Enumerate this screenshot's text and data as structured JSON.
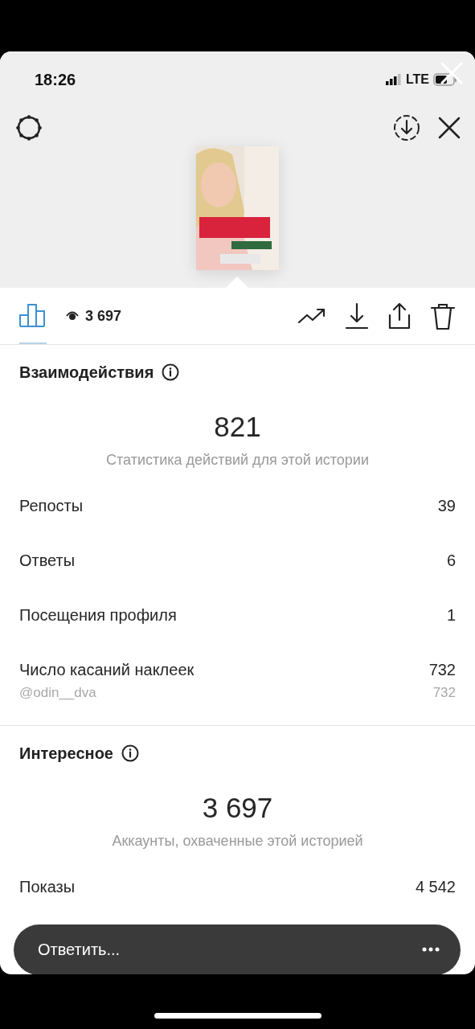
{
  "status_bar": {
    "time": "18:26",
    "network": "LTE"
  },
  "toolbar": {
    "insights_tab": {
      "selected": true
    },
    "views": "3 697"
  },
  "sections": [
    {
      "title": "Взаимодействия",
      "total": "821",
      "caption": "Статистика действий для этой истории",
      "rows": [
        {
          "kind": "main",
          "label": "Репосты",
          "value": "39"
        },
        {
          "kind": "main",
          "label": "Ответы",
          "value": "6"
        },
        {
          "kind": "main",
          "label": "Посещения профиля",
          "value": "1"
        },
        {
          "kind": "main",
          "label": "Число касаний наклеек",
          "value": "732"
        },
        {
          "kind": "sub",
          "label": "@odin__dva",
          "value": "732"
        }
      ]
    },
    {
      "title": "Интересное",
      "total": "3 697",
      "caption": "Аккаунты, охваченные этой историей",
      "rows": [
        {
          "kind": "main",
          "label": "Показы",
          "value": "4 542"
        }
      ]
    }
  ],
  "reply_bar": {
    "placeholder": "Ответить..."
  }
}
